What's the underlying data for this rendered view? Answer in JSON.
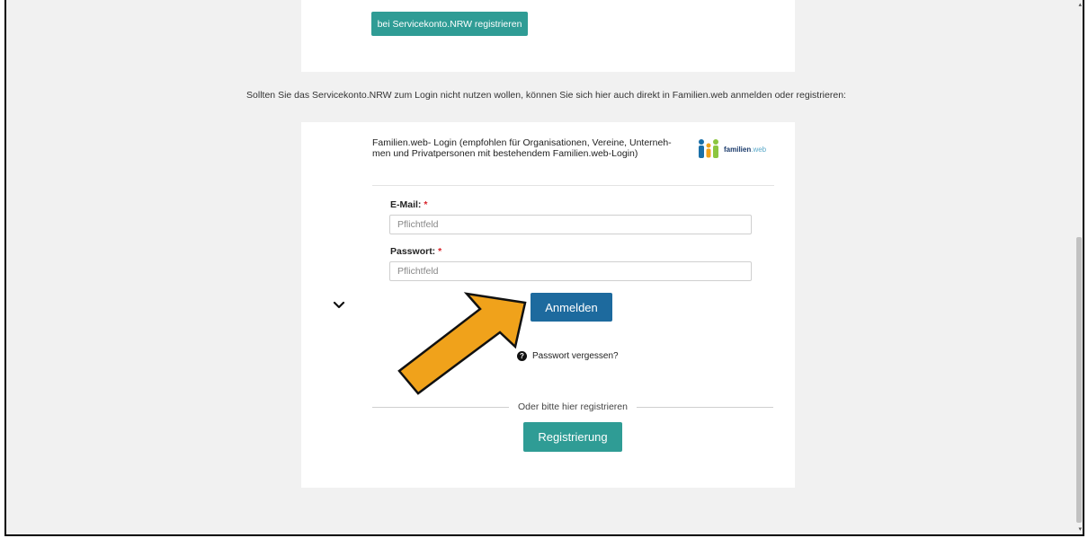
{
  "top_card": {
    "service_button_label": "bei Servicekonto.NRW registrieren"
  },
  "info_text": "Sollten Sie das Servicekonto.NRW zum Login nicht nutzen wollen, können Sie sich hier auch direkt in Familien.web anmelden oder registrieren:",
  "login": {
    "header": "Familien.web- Login (empfohlen für Organisationen, Vereine, Unterneh-men und Privatpersonen mit bestehendem Familien.web-Login)",
    "header_line1": "Familien.web- Login (empfohlen für Organisationen, Vereine, Unterneh-",
    "header_line2": "men und Privatpersonen mit bestehendem Familien.web-Login)",
    "logo": {
      "name": "familien",
      "suffix": ".web"
    },
    "email_label": "E-Mail:",
    "password_label": "Passwort:",
    "required_mark": "*",
    "email_placeholder": "Pflichtfeld",
    "password_placeholder": "Pflichtfeld",
    "login_button": "Anmelden",
    "forgot_password": "Passwort vergessen?",
    "divider_text": "Oder bitte hier registrieren",
    "register_button": "Registrierung"
  },
  "colors": {
    "teal": "#2f9c95",
    "login_blue": "#1d6a9e",
    "arrow_orange": "#f0a21b",
    "required_red": "#d8232a",
    "page_bg": "#f1f1f1"
  },
  "icons": [
    "chevron-down-icon",
    "question-circle-icon",
    "familien-web-logo",
    "annotation-arrow"
  ]
}
